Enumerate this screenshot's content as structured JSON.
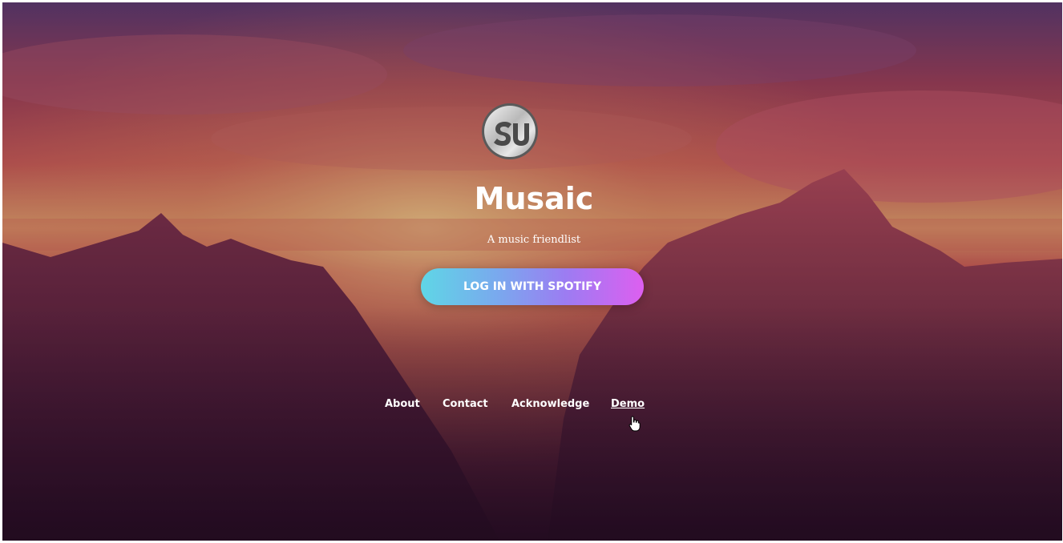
{
  "brand": {
    "logo_icon": "stumbleupon-logo-icon",
    "title": "Musaic",
    "subtitle": "A music friendlist"
  },
  "login": {
    "button_label": "LOG IN WITH SPOTIFY"
  },
  "nav": {
    "items": [
      {
        "label": "About"
      },
      {
        "label": "Contact"
      },
      {
        "label": "Acknowledge"
      },
      {
        "label": "Demo"
      }
    ]
  },
  "colors": {
    "button_gradient_start": "#5fd6e6",
    "button_gradient_end": "#dd5ff0",
    "text": "#ffffff"
  },
  "background": {
    "description_icon": "mountain-sunset-background"
  },
  "cursor": {
    "icon": "hand-pointer-icon"
  }
}
